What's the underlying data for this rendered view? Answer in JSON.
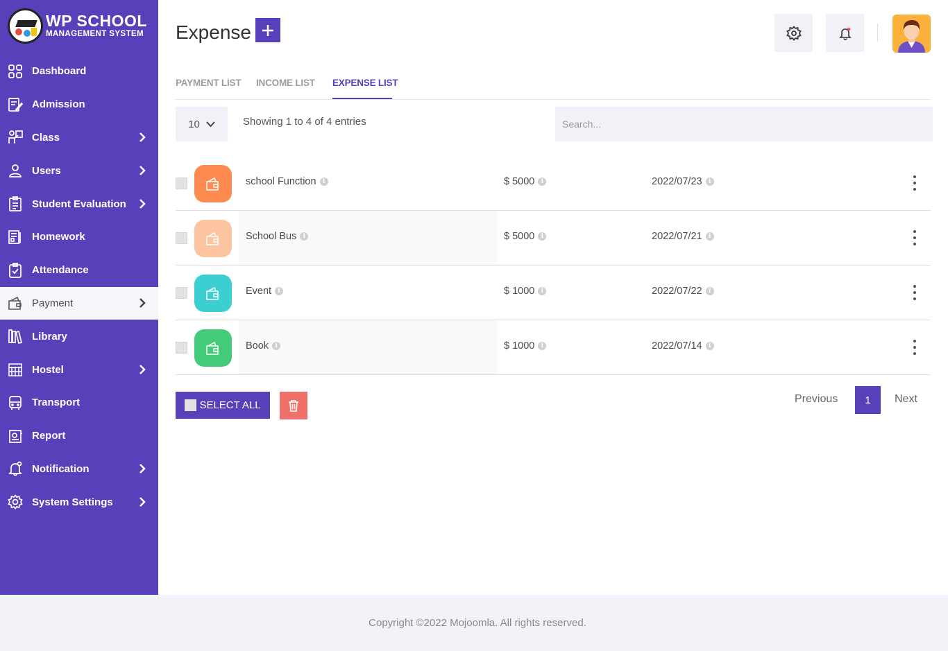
{
  "app": {
    "title": "WP SCHOOL",
    "subtitle": "MANAGEMENT SYSTEM"
  },
  "sidebar": {
    "items": [
      {
        "label": "Dashboard",
        "icon": "dashboard-icon",
        "chevron": false
      },
      {
        "label": "Admission",
        "icon": "admission-icon",
        "chevron": false
      },
      {
        "label": "Class",
        "icon": "class-icon",
        "chevron": true
      },
      {
        "label": "Users",
        "icon": "user-icon",
        "chevron": true
      },
      {
        "label": "Student Evaluation",
        "icon": "evaluation-icon",
        "chevron": true
      },
      {
        "label": "Homework",
        "icon": "homework-icon",
        "chevron": false
      },
      {
        "label": "Attendance",
        "icon": "attendance-icon",
        "chevron": false
      },
      {
        "label": "Payment",
        "icon": "wallet-icon",
        "chevron": true,
        "active": true
      },
      {
        "label": "Library",
        "icon": "library-icon",
        "chevron": false
      },
      {
        "label": "Hostel",
        "icon": "hostel-icon",
        "chevron": true
      },
      {
        "label": "Transport",
        "icon": "bus-icon",
        "chevron": false
      },
      {
        "label": "Report",
        "icon": "report-icon",
        "chevron": false
      },
      {
        "label": "Notification",
        "icon": "bell-icon",
        "chevron": true
      },
      {
        "label": "System Settings",
        "icon": "gear-icon",
        "chevron": true
      }
    ]
  },
  "header": {
    "title": "Expense",
    "add_label": "+"
  },
  "tabs": [
    {
      "label": "PAYMENT LIST",
      "active": false
    },
    {
      "label": "INCOME LIST",
      "active": false
    },
    {
      "label": "EXPENSE LIST",
      "active": true
    }
  ],
  "table": {
    "page_length": "10",
    "info": "Showing 1 to 4 of 4 entries",
    "search_placeholder": "Search...",
    "rows": [
      {
        "name": "school Function",
        "amount": "$ 5000",
        "date": "2022/07/23",
        "color": "#fd8a4e"
      },
      {
        "name": "School Bus",
        "amount": "$ 5000",
        "date": "2022/07/21",
        "color": "#fcc4a1"
      },
      {
        "name": "Event",
        "amount": "$ 1000",
        "date": "2022/07/22",
        "color": "#3ccfd2"
      },
      {
        "name": "Book",
        "amount": "$ 1000",
        "date": "2022/07/14",
        "color": "#43cb79"
      }
    ]
  },
  "actions": {
    "select_all": "SELECT ALL"
  },
  "pagination": {
    "previous": "Previous",
    "current": "1",
    "next": "Next"
  },
  "footer": {
    "copyright": "Copyright ©2022 Mojoomla. All rights reserved."
  },
  "colors": {
    "primary": "#5840bb",
    "danger": "#f0706a",
    "surface": "#f0f2f8"
  }
}
